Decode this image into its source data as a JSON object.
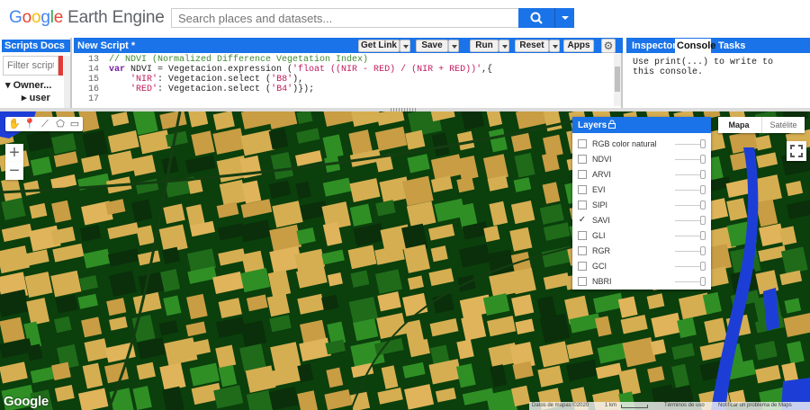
{
  "app": {
    "logo": {
      "g1": "G",
      "g2": "o",
      "g3": "o",
      "g4": "g",
      "g5": "l",
      "g6": "e",
      "product": "Earth Engine"
    },
    "search": {
      "placeholder": "Search places and datasets..."
    }
  },
  "left_panel": {
    "tabs": [
      "Scripts",
      "Docs"
    ],
    "filter_placeholder": "Filter scripts",
    "owner_label": "Owner...",
    "user_label": "user"
  },
  "script_panel": {
    "title": "New Script *",
    "buttons": {
      "get_link": "Get Link",
      "save": "Save",
      "run": "Run",
      "reset": "Reset",
      "apps": "Apps"
    },
    "lines": [
      {
        "num": "13",
        "segments": [
          {
            "cls": "c-comment",
            "text": "// NDVI (Normalized Difference Vegetation Index)"
          }
        ]
      },
      {
        "num": "14",
        "segments": [
          {
            "cls": "c-kw",
            "text": "var"
          },
          {
            "cls": "c-plain",
            "text": " NDVI = Vegetacion.expression ("
          },
          {
            "cls": "c-str",
            "text": "'float ((NIR - RED) / (NIR + RED))'"
          },
          {
            "cls": "c-plain",
            "text": ",{"
          }
        ]
      },
      {
        "num": "15",
        "segments": [
          {
            "cls": "c-plain",
            "text": "    "
          },
          {
            "cls": "c-str",
            "text": "'NIR'"
          },
          {
            "cls": "c-plain",
            "text": ": Vegetacion.select ("
          },
          {
            "cls": "c-str",
            "text": "'B8'"
          },
          {
            "cls": "c-plain",
            "text": "),"
          }
        ]
      },
      {
        "num": "16",
        "segments": [
          {
            "cls": "c-plain",
            "text": "    "
          },
          {
            "cls": "c-str",
            "text": "'RED'"
          },
          {
            "cls": "c-plain",
            "text": ": Vegetacion.select ("
          },
          {
            "cls": "c-str",
            "text": "'B4'"
          },
          {
            "cls": "c-plain",
            "text": ")});"
          }
        ]
      },
      {
        "num": "17",
        "segments": []
      }
    ]
  },
  "console_panel": {
    "tabs": [
      "Inspector",
      "Console",
      "Tasks"
    ],
    "active_tab": "Console",
    "text": "Use print(...) to write to\nthis console."
  },
  "map": {
    "zoom_in": "+",
    "zoom_out": "−",
    "layers_title": "Layers",
    "layers": [
      {
        "name": "RGB color natural",
        "checked": false
      },
      {
        "name": "NDVI",
        "checked": false
      },
      {
        "name": "ARVI",
        "checked": false
      },
      {
        "name": "EVI",
        "checked": false
      },
      {
        "name": "SIPI",
        "checked": false
      },
      {
        "name": "SAVI",
        "checked": true
      },
      {
        "name": "GLI",
        "checked": false
      },
      {
        "name": "RGR",
        "checked": false
      },
      {
        "name": "GCI",
        "checked": false
      },
      {
        "name": "NBRI",
        "checked": false
      }
    ],
    "maptype": {
      "map": "Mapa",
      "satellite": "Satélite"
    },
    "watermark": "Google",
    "attribution": {
      "data": "Datos de mapas ©2020",
      "scale": "1 km",
      "terms": "Términos de uso",
      "report": "Notificar un problema de Maps"
    },
    "colors": {
      "field_yellow": "#d6ae52",
      "dark_green": "#0b3f0c",
      "bright_green": "#2f8f25",
      "water_blue": "#1d3ed6"
    }
  }
}
